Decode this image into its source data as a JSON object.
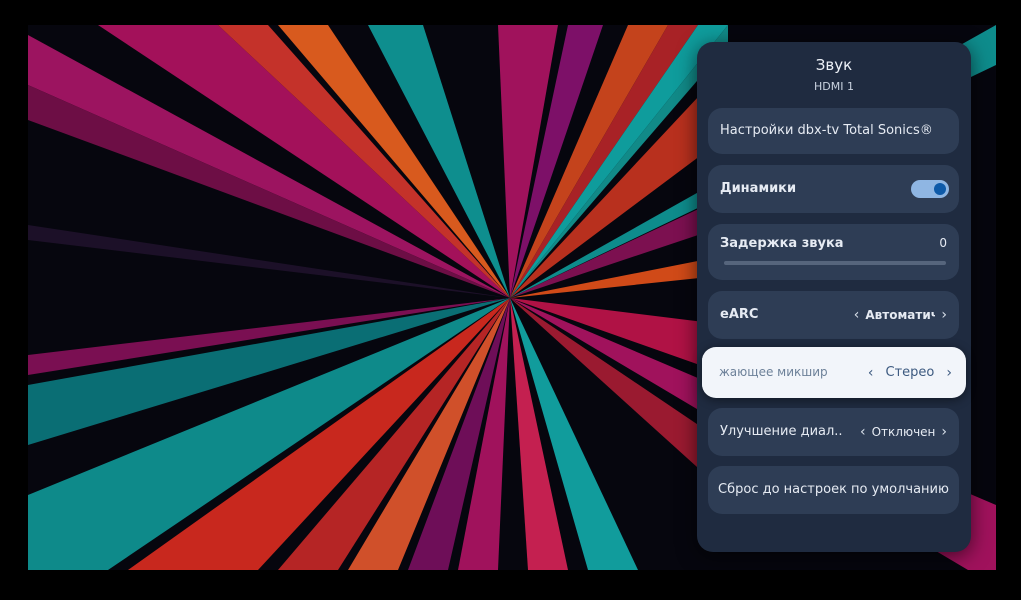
{
  "panel": {
    "title": "Звук",
    "subtitle": "HDMI 1"
  },
  "items": {
    "dbx": {
      "label": "Настройки dbx-tv Total Sonics®"
    },
    "speakers": {
      "label": "Динамики",
      "toggle_on": true
    },
    "delay": {
      "label": "Задержка звука",
      "value": "0",
      "level": 0
    },
    "earc": {
      "label": "eARC",
      "value": "Автоматич"
    },
    "downmix": {
      "label": "жающее микшир",
      "value": "Стерео"
    },
    "dialog": {
      "label": "Улучшение диал..",
      "value": "Отключен"
    },
    "reset": {
      "label": "Сброс до настроек по умолчанию"
    }
  },
  "icons": {
    "left": "chevron-left-icon",
    "right": "chevron-right-icon"
  },
  "colors": {
    "panel_bg": "#1f2b40",
    "row_bg": "#2e3d55",
    "focused_bg": "#f2f5fa",
    "toggle_track": "#8fb6e3",
    "toggle_knob": "#0e5aa8"
  }
}
